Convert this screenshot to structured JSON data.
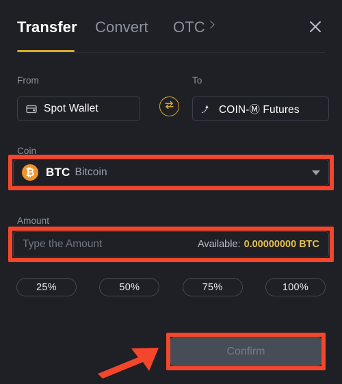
{
  "window": {
    "background_color": "#1e2026",
    "accent_color": "#d8a92c",
    "highlight_color": "#f4462a"
  },
  "header": {
    "tabs": [
      {
        "label": "Transfer",
        "active": true
      },
      {
        "label": "Convert",
        "active": false
      },
      {
        "label": "OTC",
        "active": false,
        "chevron": "chevron-right-icon"
      }
    ],
    "close_icon": "close-icon"
  },
  "transfer": {
    "from": {
      "label": "From",
      "icon": "wallet-icon",
      "value": "Spot Wallet"
    },
    "swap": {
      "icon": "swap-arrows-icon"
    },
    "to": {
      "label": "To",
      "icon": "futures-trend-icon",
      "value": "COIN-Ⓜ Futures"
    },
    "coin": {
      "label": "Coin",
      "icon": "bitcoin-icon",
      "icon_glyph": "₿",
      "icon_color": "#f0932b",
      "symbol": "BTC",
      "name": "Bitcoin",
      "caret": "chevron-down-icon"
    },
    "amount": {
      "label": "Amount",
      "placeholder": "Type the Amount",
      "value": "",
      "available_label": "Available:",
      "available_value": "0.00000000 BTC",
      "available_color": "#e5c04a"
    },
    "percent_buttons": [
      "25%",
      "50%",
      "75%",
      "100%"
    ],
    "confirm": {
      "label": "Confirm",
      "enabled": false
    }
  },
  "annotations": {
    "boxes": [
      "coin-selector",
      "amount-field",
      "confirm-button"
    ],
    "arrow": "red-arrow-pointing-to-confirm"
  }
}
